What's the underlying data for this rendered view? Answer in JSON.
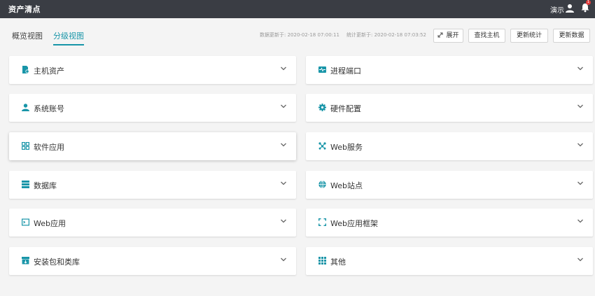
{
  "header": {
    "title": "资产清点",
    "user_label": "演示",
    "notification_count": "1"
  },
  "tabs": [
    {
      "label": "概览视图",
      "active": false
    },
    {
      "label": "分级视图",
      "active": true
    }
  ],
  "meta": {
    "data_updated": "数据更新于: 2020-02-18 07:00:11",
    "stats_updated": "统计更新于: 2020-02-18 07:03:52"
  },
  "toolbar": {
    "expand_label": "展开",
    "find_host_label": "查找主机",
    "update_stats_label": "更新统计",
    "update_data_label": "更新数据"
  },
  "panels": [
    {
      "label": "主机资产",
      "icon": "host-file-icon"
    },
    {
      "label": "进程端口",
      "icon": "pulse-icon"
    },
    {
      "label": "系统账号",
      "icon": "person-icon"
    },
    {
      "label": "硬件配置",
      "icon": "gear-icon"
    },
    {
      "label": "软件应用",
      "icon": "grid-icon"
    },
    {
      "label": "Web服务",
      "icon": "network-icon"
    },
    {
      "label": "数据库",
      "icon": "database-icon"
    },
    {
      "label": "Web站点",
      "icon": "globe-icon"
    },
    {
      "label": "Web应用",
      "icon": "terminal-icon"
    },
    {
      "label": "Web应用框架",
      "icon": "frame-icon"
    },
    {
      "label": "安装包和类库",
      "icon": "package-icon"
    },
    {
      "label": "其他",
      "icon": "dots-grid-icon"
    }
  ],
  "colors": {
    "accent": "#1895a8",
    "header_bg": "#3a3d44",
    "page_bg": "#f4f4f4",
    "badge": "#e23c3c"
  }
}
